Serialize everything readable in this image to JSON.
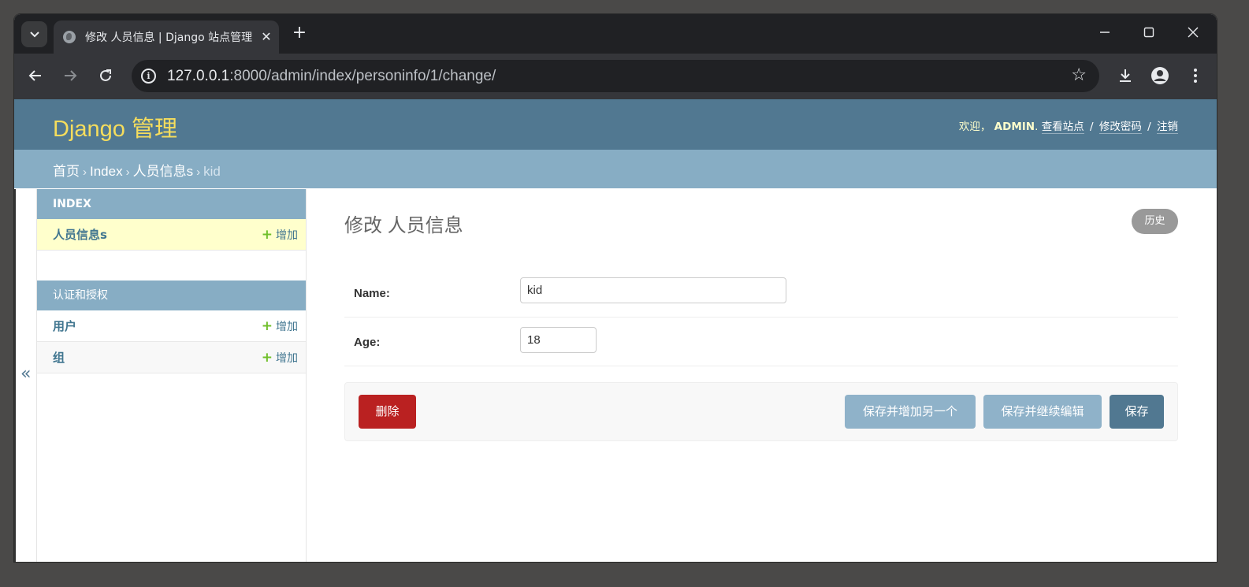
{
  "browser": {
    "tab_title": "修改 人员信息 | Django 站点管理",
    "url_host": "127.0.0.1",
    "url_rest": ":8000/admin/index/personinfo/1/change/"
  },
  "header": {
    "branding": "Django 管理",
    "welcome": "欢迎，",
    "username": "ADMIN",
    "view_site": "查看站点",
    "change_password": "修改密码",
    "logout": "注销"
  },
  "breadcrumbs": {
    "home": "首页",
    "app": "Index",
    "model": "人员信息s",
    "current": "kid"
  },
  "sidebar": {
    "toggle": "«",
    "modules": [
      {
        "caption": "INDEX",
        "rows": [
          {
            "name": "人员信息s",
            "add": "增加"
          }
        ]
      },
      {
        "caption": "认证和授权",
        "rows": [
          {
            "name": "用户",
            "add": "增加"
          },
          {
            "name": "组",
            "add": "增加"
          }
        ]
      }
    ]
  },
  "content": {
    "title": "修改 人员信息",
    "history": "历史",
    "fields": {
      "name_label": "Name:",
      "name_value": "kid",
      "age_label": "Age:",
      "age_value": "18"
    },
    "buttons": {
      "delete": "删除",
      "save_add_another": "保存并增加另一个",
      "save_continue": "保存并继续编辑",
      "save": "保存"
    }
  },
  "colors": {
    "header": "#517891",
    "breadcrumbs": "#87adc4",
    "branding": "#f5dd5d",
    "delete": "#ba2121",
    "add_plus": "#70bf2b"
  }
}
